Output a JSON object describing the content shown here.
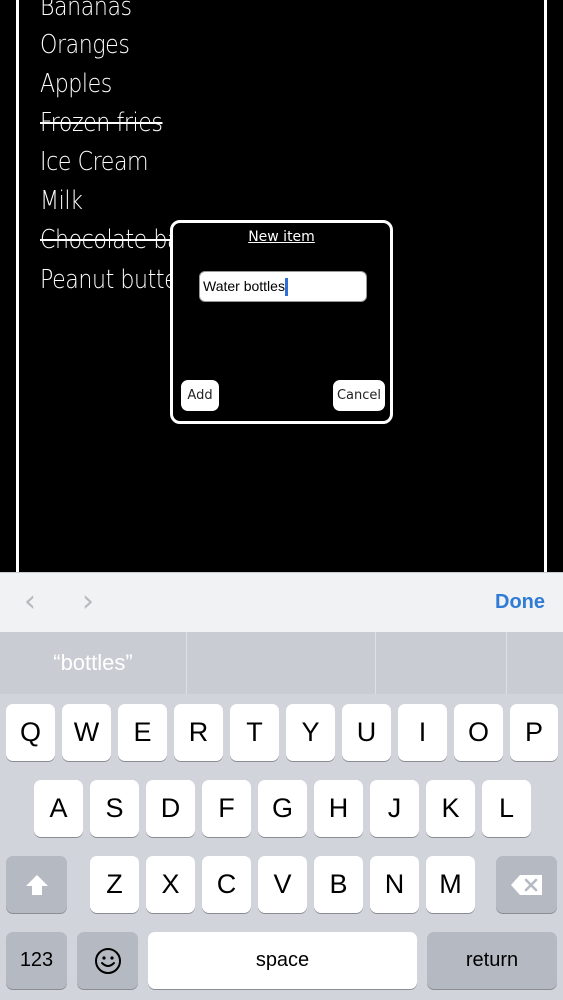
{
  "list": {
    "items": [
      {
        "label": "Bananas",
        "done": false
      },
      {
        "label": "Oranges",
        "done": false
      },
      {
        "label": "Apples",
        "done": false
      },
      {
        "label": "Frozen fries",
        "done": true
      },
      {
        "label": "Ice Cream",
        "done": false
      },
      {
        "label": "Milk",
        "done": false
      },
      {
        "label": "Chocolate ba",
        "done": true
      },
      {
        "label": "Peanut butte",
        "done": false
      }
    ]
  },
  "dialog": {
    "title": "New item",
    "input_value": "Water bottles",
    "add_label": "Add",
    "cancel_label": "Cancel"
  },
  "toolbar": {
    "prev_icon": "chevron-left-icon",
    "next_icon": "chevron-right-icon",
    "done_label": "Done"
  },
  "suggestions": [
    "“bottles”",
    "",
    ""
  ],
  "keyboard": {
    "row1": [
      "Q",
      "W",
      "E",
      "R",
      "T",
      "Y",
      "U",
      "I",
      "O",
      "P"
    ],
    "row2": [
      "A",
      "S",
      "D",
      "F",
      "G",
      "H",
      "J",
      "K",
      "L"
    ],
    "row3": [
      "Z",
      "X",
      "C",
      "V",
      "B",
      "N",
      "M"
    ],
    "numbers_label": "123",
    "space_label": "space",
    "return_label": "return",
    "shift_icon": "shift-arrow-icon",
    "delete_icon": "backspace-icon",
    "emoji_icon": "emoji-icon"
  }
}
